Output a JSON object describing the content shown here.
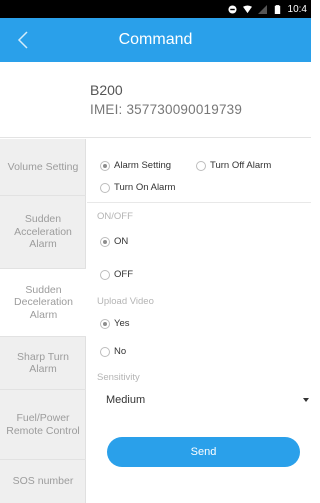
{
  "status_bar": {
    "time": "10:4"
  },
  "header": {
    "title": "Command"
  },
  "device": {
    "name": "B200",
    "imei": "IMEI: 357730090019739"
  },
  "sidebar": {
    "items": [
      {
        "label": "Volume Setting",
        "active": false
      },
      {
        "label": "Sudden Acceleration Alarm",
        "active": false
      },
      {
        "label": "Sudden Deceleration Alarm",
        "active": true
      },
      {
        "label": "Sharp Turn Alarm",
        "active": false
      },
      {
        "label": "Fuel/Power Remote Control",
        "active": false
      },
      {
        "label": "SOS number",
        "active": false
      }
    ]
  },
  "form": {
    "mode_options": {
      "alarm_setting": "Alarm Setting",
      "turn_off_alarm": "Turn Off Alarm",
      "turn_on_alarm": "Turn On Alarm",
      "selected": "Alarm Setting"
    },
    "onoff": {
      "label": "ON/OFF",
      "on": "ON",
      "off": "OFF",
      "selected": "ON"
    },
    "upload_video": {
      "label": "Upload Video",
      "yes": "Yes",
      "no": "No",
      "selected": "Yes"
    },
    "sensitivity": {
      "label": "Sensitivity",
      "value": "Medium"
    },
    "send_label": "Send"
  },
  "colors": {
    "accent": "#2aa0ea",
    "sidebar_bg": "#efefef"
  }
}
